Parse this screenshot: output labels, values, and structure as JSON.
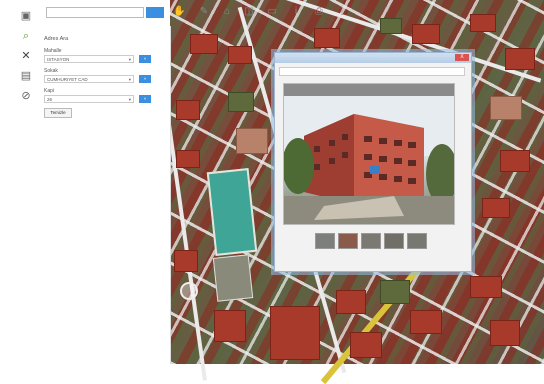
{
  "toolbar": {
    "search_value": "",
    "search_button_label": "",
    "icons": [
      "hand-icon",
      "pencil-icon",
      "home-icon",
      "layers-icon",
      "monitor-icon",
      "info-icon",
      "print-icon",
      "menu-dots-icon"
    ]
  },
  "left_tools": [
    "window-icon",
    "search-icon",
    "close-icon",
    "document-icon",
    "compass-icon"
  ],
  "panel": {
    "heading": "Adres Ara",
    "fields": [
      {
        "label": "Mahalle",
        "value": "ISTASYON",
        "button": "»"
      },
      {
        "label": "Sokak",
        "value": "CUMHURIYET CAD",
        "button": "»"
      },
      {
        "label": "Kapi",
        "value": "26",
        "button": "»"
      }
    ],
    "clear_label": "Temizle"
  },
  "popup": {
    "close_label": "X",
    "url_text": "",
    "caption": "",
    "thumbnail_count": 5
  },
  "colors": {
    "accent": "#3a8fe0",
    "court": "#3fa597",
    "roof": "#a83a2c"
  }
}
